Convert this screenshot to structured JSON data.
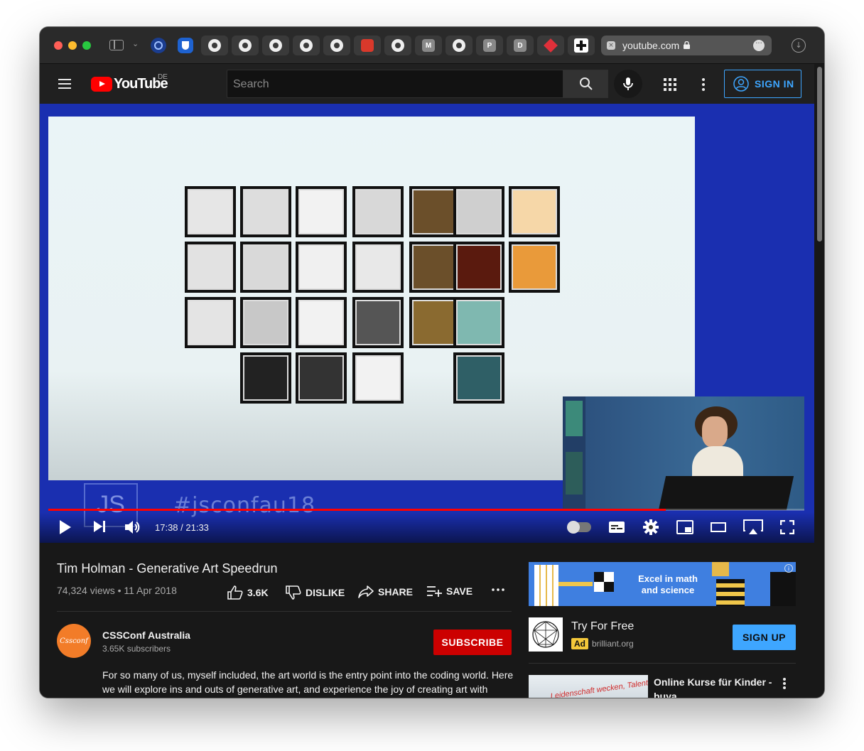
{
  "browser": {
    "url": "youtube.com",
    "favicon_letters": [
      "M",
      "P",
      "D"
    ]
  },
  "header": {
    "logo_text": "YouTube",
    "region": "DE",
    "search_placeholder": "Search",
    "sign_in": "SIGN IN"
  },
  "player": {
    "hashtag": "#jsconfau18",
    "slide_logo": "JS",
    "current_time": "17:38",
    "duration": "21:33",
    "time_display": "17:38 / 21:33",
    "progress": 0.817
  },
  "video": {
    "title": "Tim Holman - Generative Art Speedrun",
    "meta": "74,324 views • 11 Apr 2018",
    "likes": "3.6K",
    "dislike_label": "DISLIKE",
    "share_label": "SHARE",
    "save_label": "SAVE"
  },
  "channel": {
    "name": "CSSConf Australia",
    "subscribers": "3.65K subscribers",
    "avatar_text": "Cssconf",
    "subscribe_label": "SUBSCRIBE"
  },
  "description": "For so many of us, myself included, the art world is the entry point into the coding world. Here we will explore ins and outs of generative art, and experience the joy of creating art with",
  "ad": {
    "banner_text": "Excel in math and science",
    "title": "Try For Free",
    "badge": "Ad",
    "domain": "brilliant.org",
    "cta": "SIGN UP"
  },
  "recommended": {
    "title": "Online Kurse für Kinder - buya",
    "thumb_text": "Leidenschaft wecken, Talent fördern!"
  },
  "colors": {
    "accent_blue": "#3ea6ff",
    "youtube_red": "#ff0000",
    "subscribe_red": "#cc0000",
    "player_background": "#1a2fb0"
  }
}
